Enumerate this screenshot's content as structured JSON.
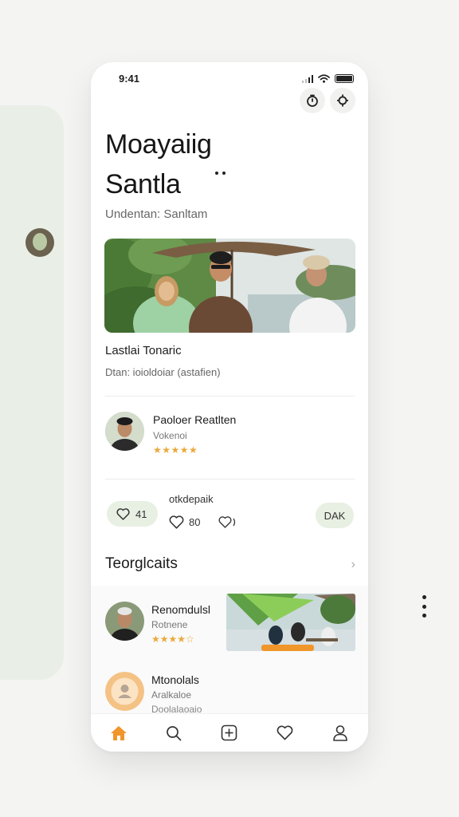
{
  "status_bar": {
    "time": "9:41"
  },
  "page": {
    "title_line1": "Moayaiig",
    "title_line2": "Santla",
    "subtitle": "Undentan: Sanltam"
  },
  "hero": {
    "title": "Lastlai Tonaric",
    "subtitle": "Dtan: ioioldoiar (astafien)"
  },
  "host": {
    "name": "Paoloer Reatlten",
    "role": "Vokenoi",
    "rating": 5,
    "stars": "★★★★★"
  },
  "engagement": {
    "label": "otkdepaik",
    "likes": "41",
    "hearts": "80",
    "extra_label": "DAK"
  },
  "section": {
    "title": "Teorglcaits"
  },
  "list": [
    {
      "name": "Renomdulsl",
      "sub": "Rotnene",
      "stars": "★★★★☆",
      "rating": 4
    },
    {
      "name": "Mtonolals",
      "sub": "Aralkaloe",
      "sub2": "Doolalaoaio"
    }
  ],
  "tabs": [
    "home-icon",
    "search-icon",
    "add-icon",
    "heart-icon",
    "profile-icon"
  ],
  "colors": {
    "accent": "#f0962a",
    "pill": "#e8efe3",
    "star": "#eba93a",
    "side_panel": "#e9efe6"
  }
}
